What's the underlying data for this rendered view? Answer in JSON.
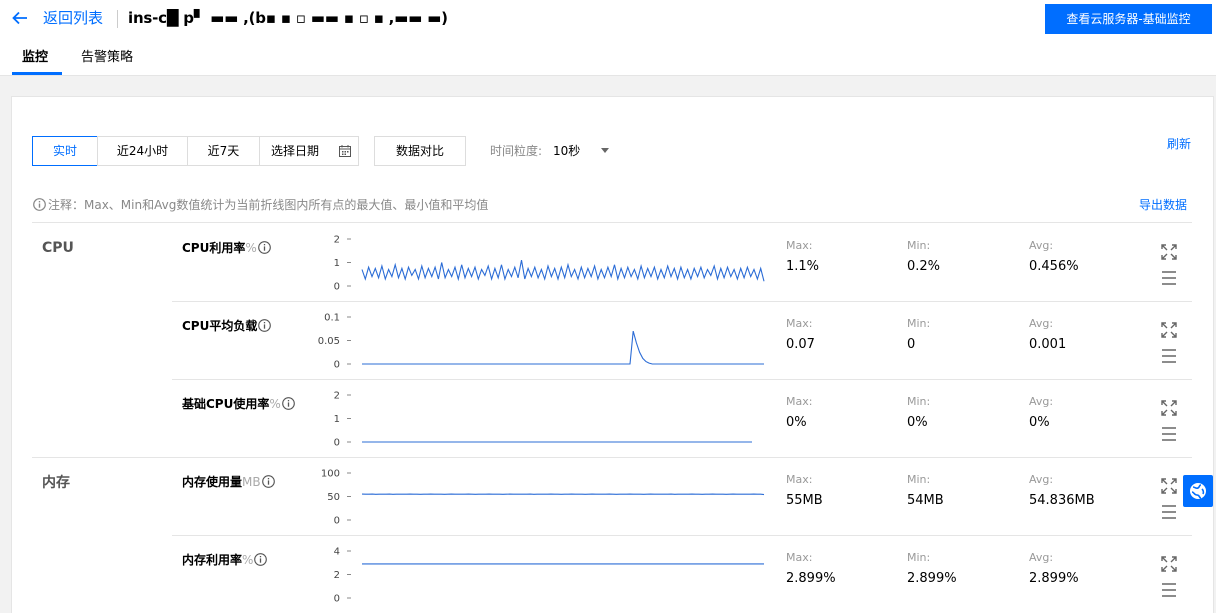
{
  "header": {
    "back_label": "返回列表",
    "instance_title": "ins-c█ p▘ ▬▬ ,(b▪ ▪ ▫ ▬▬ ▪ ▫ ▪ ,▬▬ ▬)",
    "primary_button": "查看云服务器-基础监控"
  },
  "tabs": [
    {
      "label": "监控",
      "active": true
    },
    {
      "label": "告警策略",
      "active": false
    }
  ],
  "toolbar": {
    "time_ranges": [
      "实时",
      "近24小时",
      "近7天"
    ],
    "active_range": "实时",
    "date_picker": "选择日期",
    "compare": "数据对比",
    "granularity_label": "时间粒度:",
    "granularity_value": "10秒",
    "refresh": "刷新"
  },
  "note": "注释：Max、Min和Avg数值统计为当前折线图内所有点的最大值、最小值和平均值",
  "export": "导出数据",
  "stat_labels": {
    "max": "Max:",
    "min": "Min:",
    "avg": "Avg:"
  },
  "groups": [
    {
      "label": "CPU"
    },
    {
      "label": "内存"
    }
  ],
  "metrics": [
    {
      "name": "CPU利用率",
      "unit": "%",
      "max": "1.1%",
      "min": "0.2%",
      "avg": "0.456%",
      "yticks": [
        "2",
        "1",
        "0"
      ]
    },
    {
      "name": "CPU平均负载",
      "unit": "",
      "max": "0.07",
      "min": "0",
      "avg": "0.001",
      "yticks": [
        "0.1",
        "0.05",
        "0"
      ]
    },
    {
      "name": "基础CPU使用率",
      "unit": "%",
      "max": "0%",
      "min": "0%",
      "avg": "0%",
      "yticks": [
        "2",
        "1",
        "0"
      ]
    },
    {
      "name": "内存使用量",
      "unit": "MB",
      "max": "55MB",
      "min": "54MB",
      "avg": "54.836MB",
      "yticks": [
        "100",
        "50",
        "0"
      ]
    },
    {
      "name": "内存利用率",
      "unit": "%",
      "max": "2.899%",
      "min": "2.899%",
      "avg": "2.899%",
      "yticks": [
        "4",
        "2",
        "0"
      ]
    }
  ],
  "chart_data": [
    {
      "type": "line",
      "title": "CPU利用率",
      "ylim": [
        0,
        2
      ],
      "y_ticks": [
        0,
        1,
        2
      ],
      "series": [
        {
          "values": [
            0.7,
            0.3,
            0.8,
            0.4,
            0.75,
            0.35,
            0.85,
            0.3,
            0.7,
            0.4,
            0.9,
            0.35,
            0.75,
            0.3,
            0.8,
            0.45,
            0.7,
            0.3,
            0.85,
            0.35,
            0.75,
            0.4,
            0.8,
            0.3,
            1.0,
            0.35,
            0.7,
            0.4,
            0.8,
            0.3,
            0.9,
            0.35,
            0.75,
            0.4,
            0.8,
            0.3,
            0.7,
            0.45,
            0.85,
            0.3,
            0.75,
            0.35,
            0.9,
            0.3,
            0.7,
            0.4,
            0.8,
            0.35,
            1.1,
            0.3,
            0.75,
            0.4,
            0.8,
            0.35,
            0.7,
            0.3,
            0.85,
            0.4,
            0.75,
            0.3,
            0.8,
            0.35,
            0.9,
            0.4,
            0.7,
            0.3,
            0.8,
            0.35,
            0.75,
            0.4,
            0.85,
            0.3,
            0.7,
            0.35,
            0.8,
            0.4,
            0.9,
            0.3,
            0.75,
            0.35,
            0.8,
            0.4,
            0.7,
            0.3,
            0.85,
            0.35,
            0.75,
            0.4,
            0.8,
            0.3,
            0.7,
            0.35,
            0.85,
            0.4,
            0.75,
            0.3,
            0.8,
            0.35,
            0.7,
            0.3,
            0.75,
            0.4,
            0.8,
            0.35,
            0.7,
            0.45,
            0.85,
            0.3,
            0.75,
            0.35,
            0.8,
            0.4,
            0.7,
            0.3,
            0.75,
            0.35,
            0.8,
            0.4,
            0.7,
            0.3,
            0.75,
            0.2
          ]
        }
      ]
    },
    {
      "type": "line",
      "title": "CPU平均负载",
      "ylim": [
        0,
        0.1
      ],
      "y_ticks": [
        0,
        0.05,
        0.1
      ],
      "series": [
        {
          "values": [
            0,
            0,
            0,
            0,
            0,
            0,
            0,
            0,
            0,
            0,
            0,
            0,
            0,
            0,
            0,
            0,
            0,
            0,
            0,
            0,
            0,
            0,
            0,
            0,
            0,
            0,
            0,
            0,
            0,
            0,
            0,
            0,
            0,
            0,
            0,
            0,
            0,
            0,
            0,
            0,
            0,
            0,
            0,
            0,
            0,
            0,
            0,
            0,
            0,
            0,
            0,
            0,
            0,
            0,
            0,
            0,
            0,
            0,
            0,
            0,
            0,
            0,
            0,
            0,
            0,
            0,
            0,
            0,
            0,
            0,
            0,
            0,
            0,
            0,
            0,
            0,
            0,
            0,
            0,
            0,
            0,
            0,
            0,
            0,
            0,
            0.07,
            0.045,
            0.025,
            0.012,
            0.005,
            0.002,
            0,
            0,
            0,
            0,
            0,
            0,
            0,
            0,
            0,
            0,
            0,
            0,
            0,
            0,
            0,
            0,
            0,
            0,
            0,
            0,
            0,
            0,
            0,
            0,
            0,
            0,
            0,
            0,
            0,
            0,
            0,
            0,
            0,
            0,
            0,
            0
          ]
        }
      ]
    },
    {
      "type": "line",
      "title": "基础CPU使用率",
      "ylim": [
        0,
        2
      ],
      "y_ticks": [
        0,
        1,
        2
      ],
      "series": [
        {
          "values": [
            0,
            0,
            0,
            0,
            0,
            0,
            0,
            0,
            0,
            0,
            0,
            0,
            0,
            0,
            0,
            0,
            0,
            0,
            0,
            0,
            0,
            0,
            0,
            0,
            0,
            0,
            0,
            0,
            0,
            0,
            0,
            0,
            0,
            0,
            0,
            0,
            0,
            0,
            0,
            0,
            0,
            0,
            0,
            0,
            0,
            0,
            0,
            0,
            0,
            0,
            0,
            0,
            0,
            0,
            0,
            0,
            0,
            0,
            0,
            0,
            0,
            0,
            0,
            0,
            0,
            0,
            0,
            0,
            0,
            0,
            0,
            0,
            0,
            0,
            0,
            0,
            0,
            0,
            0,
            0,
            0,
            0,
            0,
            0,
            0,
            0,
            0,
            0,
            0,
            0,
            0,
            0,
            0,
            0,
            0,
            0,
            0,
            0,
            0,
            0,
            0,
            0,
            0,
            0,
            0,
            0,
            0,
            0,
            0,
            0,
            0,
            0,
            0,
            0,
            0,
            0,
            0,
            0,
            0
          ]
        }
      ]
    },
    {
      "type": "line",
      "title": "内存使用量",
      "ylim": [
        0,
        100
      ],
      "y_ticks": [
        0,
        50,
        100
      ],
      "series": [
        {
          "values": [
            55,
            54.8,
            54.9,
            55,
            54.7,
            54.8,
            54.9,
            54.8,
            55,
            54.7,
            54.8,
            54.9,
            54.8,
            54.8,
            55,
            54.9,
            54.8,
            54.7,
            54.8,
            54.9,
            55,
            54.8,
            54.8,
            54.9,
            54.7,
            54.8,
            55,
            54.9,
            54.8,
            54.8,
            54.9,
            55,
            54.8,
            54.7,
            54.8,
            54.9,
            54.8,
            55,
            54.8,
            54.9,
            54.8,
            54.7,
            54.8,
            55,
            54.9,
            54.8,
            54.8,
            54.9,
            54.8,
            55,
            54.7,
            54.8,
            54.9,
            54.8,
            54.8,
            55,
            54.9,
            54.8,
            54.7,
            54.8,
            54.9,
            55,
            54.8,
            54.8,
            54.9,
            54.7,
            54.8,
            55,
            54.9,
            54.8,
            54.8,
            54.9,
            55,
            54.8,
            54.7,
            54.8,
            54.9,
            54.8,
            55,
            54.8,
            54.9,
            54.8,
            54.7,
            54.8,
            55,
            54.9,
            54.8,
            54.8,
            54.9,
            54.8,
            55,
            54.7,
            54.8,
            54.9,
            54.8,
            54.8,
            55,
            54.9,
            54.8,
            54.7,
            54.8,
            54.9,
            55,
            54.8,
            54.8,
            54.9,
            54.7,
            54.8,
            55,
            54.9,
            54.8,
            54.8,
            54.9,
            54.8,
            55,
            54.8,
            54.9,
            54
          ]
        }
      ]
    },
    {
      "type": "line",
      "title": "内存利用率",
      "ylim": [
        0,
        4
      ],
      "y_ticks": [
        0,
        2,
        4
      ],
      "series": [
        {
          "values": [
            2.899,
            2.899,
            2.899,
            2.899,
            2.899,
            2.899,
            2.899,
            2.899,
            2.899,
            2.899,
            2.899,
            2.899,
            2.899,
            2.899,
            2.899,
            2.899,
            2.899,
            2.899,
            2.899,
            2.899,
            2.899,
            2.899,
            2.899,
            2.899,
            2.899,
            2.899,
            2.899,
            2.899,
            2.899,
            2.899,
            2.899,
            2.899,
            2.899,
            2.899,
            2.899,
            2.899,
            2.899,
            2.899,
            2.899,
            2.899,
            2.899,
            2.899,
            2.899,
            2.899,
            2.899,
            2.899,
            2.899,
            2.899,
            2.899,
            2.899,
            2.899,
            2.899,
            2.899,
            2.899,
            2.899,
            2.899,
            2.899,
            2.899,
            2.899,
            2.899,
            2.899,
            2.899,
            2.899,
            2.899,
            2.899,
            2.899,
            2.899,
            2.899,
            2.899,
            2.899,
            2.899,
            2.899,
            2.899,
            2.899,
            2.899,
            2.899,
            2.899,
            2.899,
            2.899,
            2.899,
            2.899,
            2.899,
            2.899,
            2.899,
            2.899,
            2.899,
            2.899,
            2.899,
            2.899,
            2.899,
            2.899,
            2.899,
            2.899,
            2.899,
            2.899,
            2.899,
            2.899,
            2.899,
            2.899,
            2.899,
            2.899,
            2.899,
            2.899,
            2.899,
            2.899,
            2.899,
            2.899,
            2.899,
            2.899,
            2.899,
            2.899,
            2.899,
            2.899,
            2.899,
            2.899,
            2.899,
            2.899,
            2.899,
            2.899
          ]
        }
      ]
    }
  ],
  "colors": {
    "accent": "#006eff",
    "line": "#2b6cd6"
  }
}
